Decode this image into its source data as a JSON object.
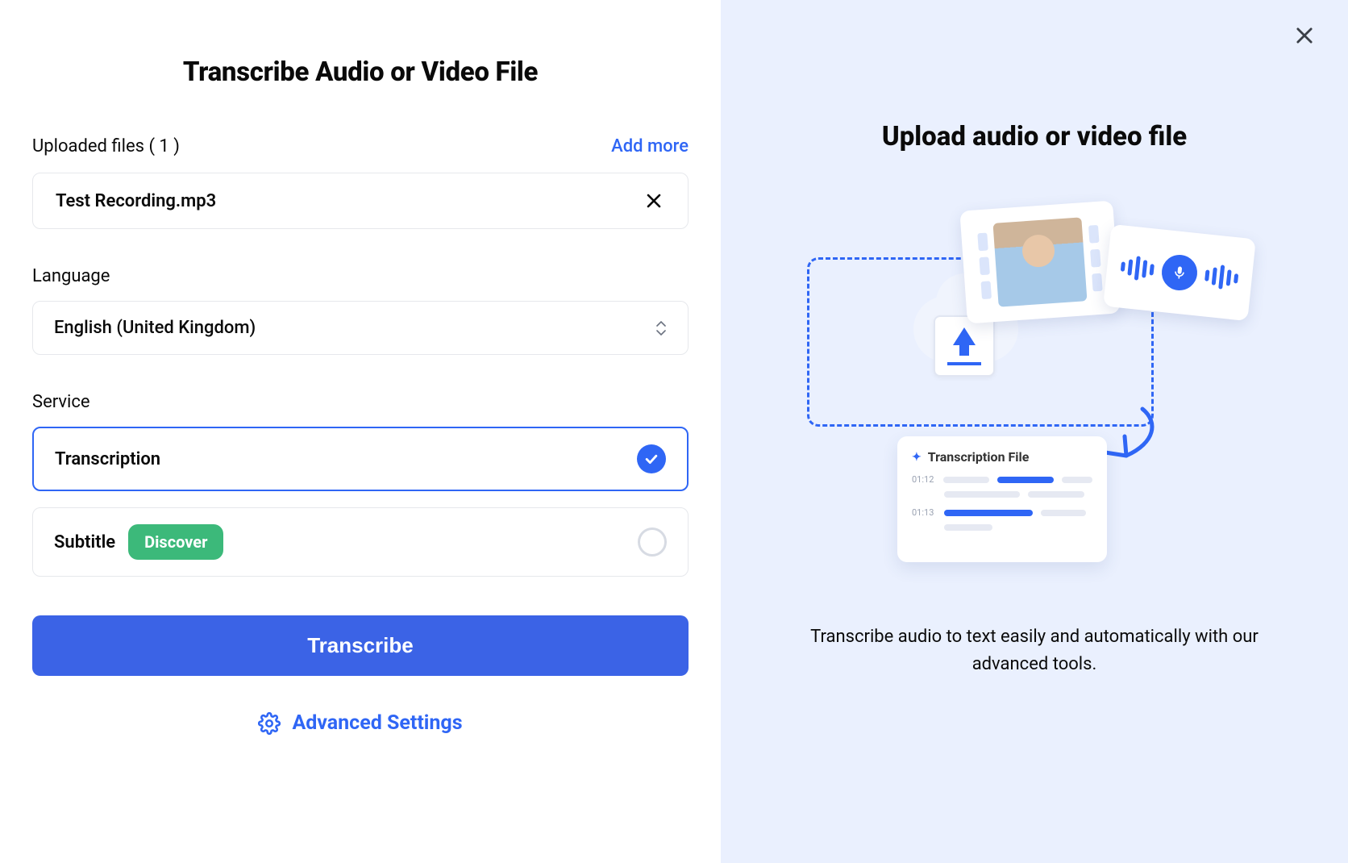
{
  "left": {
    "title": "Transcribe Audio or Video File",
    "files_label": "Uploaded files ( 1 )",
    "add_more": "Add more",
    "file_name": "Test Recording.mp3",
    "language_label": "Language",
    "language_value": "English (United Kingdom)",
    "service_label": "Service",
    "service_transcription": "Transcription",
    "service_subtitle": "Subtitle",
    "discover_badge": "Discover",
    "primary_button": "Transcribe",
    "advanced": "Advanced Settings"
  },
  "right": {
    "title": "Upload audio or video file",
    "description": "Transcribe audio to text easily and automatically with our advanced tools.",
    "result_card_title": "Transcription File",
    "time1": "01:12",
    "time2": "01:13"
  },
  "colors": {
    "accent": "#2f66f5",
    "green": "#3cb97a"
  }
}
